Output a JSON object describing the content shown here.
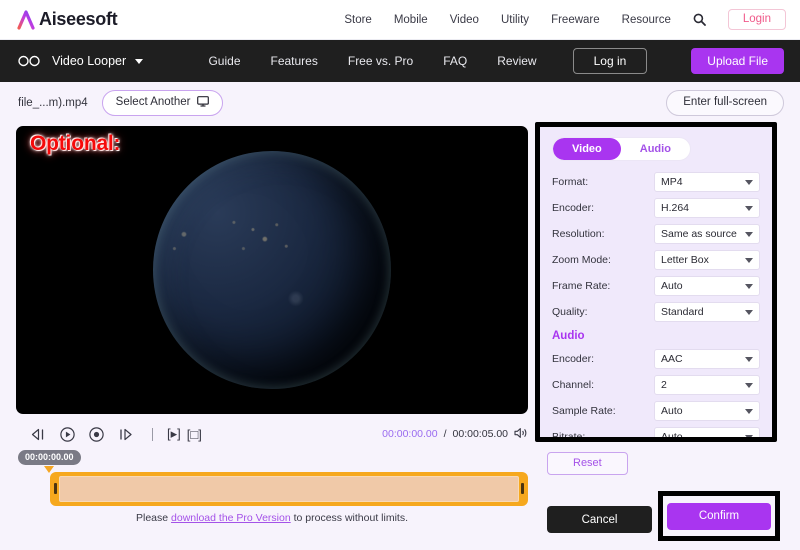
{
  "brand": {
    "name": "Aiseesoft"
  },
  "topnav": {
    "items": [
      {
        "label": "Store"
      },
      {
        "label": "Mobile"
      },
      {
        "label": "Video"
      },
      {
        "label": "Utility"
      },
      {
        "label": "Freeware"
      },
      {
        "label": "Resource"
      }
    ],
    "search_icon": "search-icon",
    "login_label": "Login"
  },
  "darknav": {
    "product": "Video Looper",
    "links": [
      {
        "label": "Guide"
      },
      {
        "label": "Features"
      },
      {
        "label": "Free vs. Pro"
      },
      {
        "label": "FAQ"
      },
      {
        "label": "Review"
      }
    ],
    "login_label": "Log in",
    "upload_label": "Upload File"
  },
  "filebar": {
    "filename": "file_...m).mp4",
    "select_another_label": "Select Another",
    "fullscreen_label": "Enter full-screen"
  },
  "video": {
    "overlay_text": "Optional:",
    "current_time": "00:00:00.00",
    "separator": "/",
    "total_time": "00:00:05.00",
    "controls": [
      {
        "name": "rewind-icon"
      },
      {
        "name": "play-circle-icon"
      },
      {
        "name": "record-circle-icon"
      },
      {
        "name": "fast-forward-icon"
      }
    ],
    "bracket_play": "[▸]",
    "bracket_stop": "[□]",
    "volume_icon": "volume-icon"
  },
  "timeline": {
    "tooltip_time": "00:00:00.00"
  },
  "pro_note": {
    "prefix": "Please ",
    "link": "download the Pro Version",
    "suffix": " to process without limits."
  },
  "panel": {
    "tabs": {
      "video": "Video",
      "audio": "Audio"
    },
    "video_settings": [
      {
        "label": "Format:",
        "value": "MP4"
      },
      {
        "label": "Encoder:",
        "value": "H.264"
      },
      {
        "label": "Resolution:",
        "value": "Same as source"
      },
      {
        "label": "Zoom Mode:",
        "value": "Letter Box"
      },
      {
        "label": "Frame Rate:",
        "value": "Auto"
      },
      {
        "label": "Quality:",
        "value": "Standard"
      }
    ],
    "audio_heading": "Audio",
    "audio_settings": [
      {
        "label": "Encoder:",
        "value": "AAC"
      },
      {
        "label": "Channel:",
        "value": "2"
      },
      {
        "label": "Sample Rate:",
        "value": "Auto"
      },
      {
        "label": "Bitrate:",
        "value": "Auto"
      }
    ],
    "reset_label": "Reset",
    "cancel_label": "Cancel",
    "confirm_label": "Confirm"
  },
  "colors": {
    "accent_purple": "#a935f0",
    "page_bg": "#f7f3fc",
    "dark_nav": "#1f1f1f",
    "timeline_orange": "#f6a81e",
    "optional_red": "#f50a0a",
    "login_pink": "#f05a8a"
  }
}
